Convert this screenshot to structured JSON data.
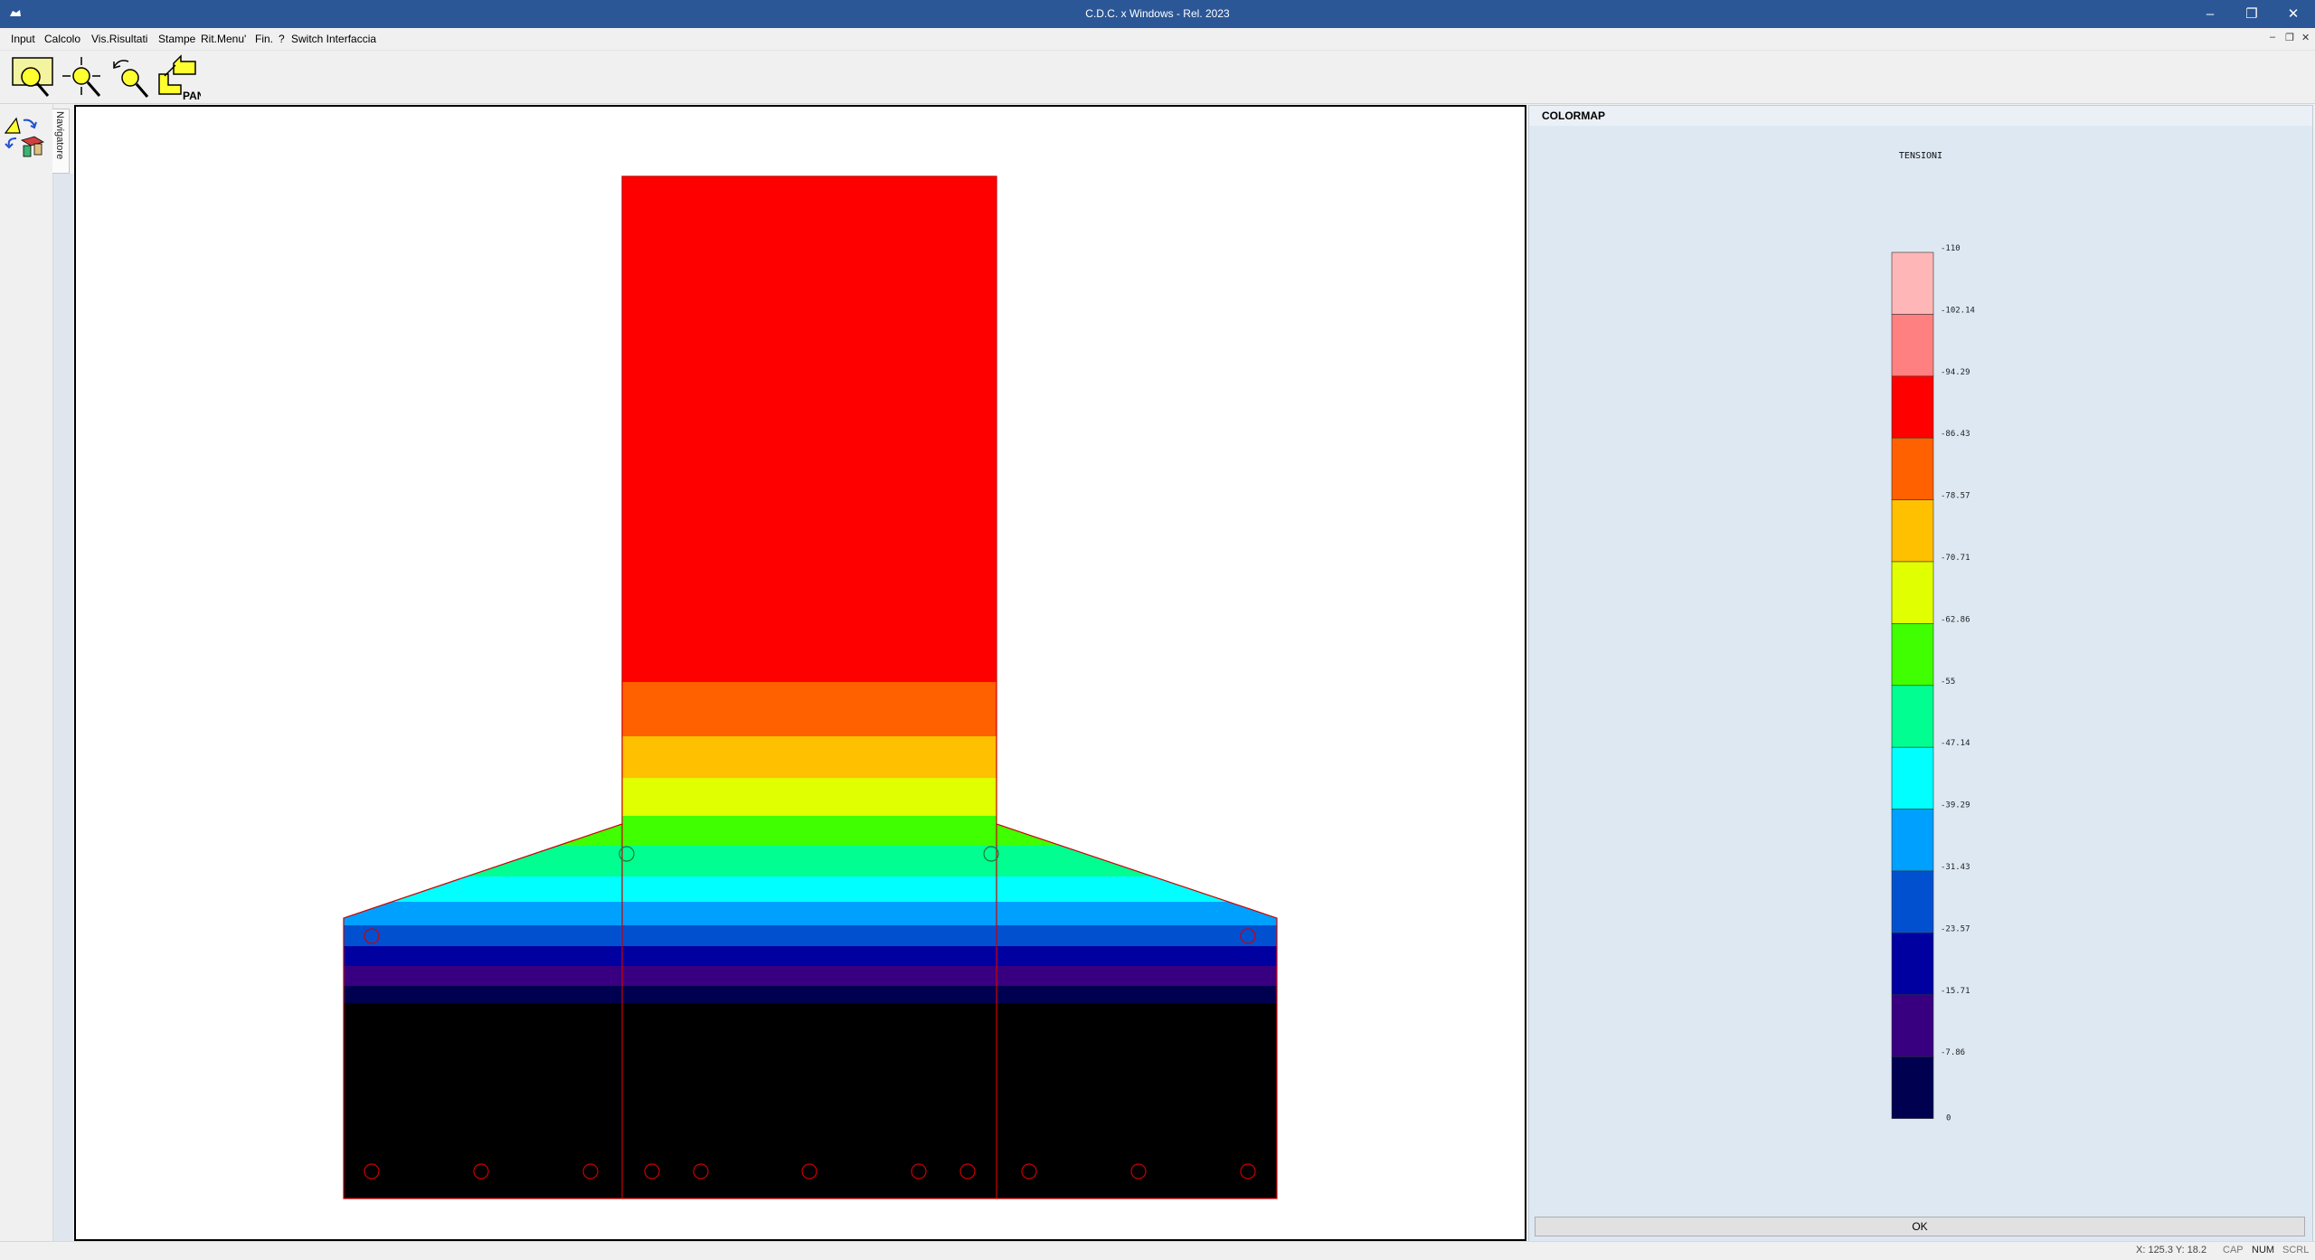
{
  "window": {
    "title": "C.D.C. x Windows - Rel. 2023"
  },
  "menu": [
    {
      "label": "Input"
    },
    {
      "label": "Calcolo"
    },
    {
      "label": "Vis.Risultati"
    },
    {
      "label": "Stampe"
    },
    {
      "label": "Rit.Menu'"
    },
    {
      "label": "Fin."
    },
    {
      "label": "?"
    },
    {
      "label": "Switch Interfaccia"
    }
  ],
  "toolbar": {
    "tools": [
      {
        "icon": "zoom-window-icon"
      },
      {
        "icon": "zoom-extents-icon"
      },
      {
        "icon": "zoom-previous-icon"
      },
      {
        "icon": "pan-icon",
        "label": "PAN"
      }
    ]
  },
  "sidebar": {
    "tab_label": "Navigatore"
  },
  "colormap": {
    "header": "COLORMAP",
    "subtitle": "TENSIONI",
    "classes": [
      {
        "value": "-110",
        "color": "#ffb6b6"
      },
      {
        "value": "-102.14",
        "color": "#ff8080"
      },
      {
        "value": "-94.29",
        "color": "#ff0000"
      },
      {
        "value": "-86.43",
        "color": "#ff6000"
      },
      {
        "value": "-78.57",
        "color": "#ffc000"
      },
      {
        "value": "-70.71",
        "color": "#e0ff00"
      },
      {
        "value": "-62.86",
        "color": "#40ff00"
      },
      {
        "value": "-55",
        "color": "#00ff90"
      },
      {
        "value": "-47.14",
        "color": "#00ffff"
      },
      {
        "value": "-39.29",
        "color": "#00a0ff"
      },
      {
        "value": "-31.43",
        "color": "#0050d0"
      },
      {
        "value": "-23.57",
        "color": "#0000a0"
      },
      {
        "value": "-15.71",
        "color": "#380080"
      },
      {
        "value": "-7.86",
        "color": "#000050"
      }
    ],
    "last_value": "0",
    "ok_label": "OK"
  },
  "model": {
    "base_fill": "#000000",
    "outline_color": "#cc0000",
    "rebar_count": 15
  },
  "status": {
    "coords": "X: 125.3  Y: 18.2",
    "indicators": [
      {
        "label": "CAP",
        "active": false
      },
      {
        "label": "NUM",
        "active": true
      },
      {
        "label": "SCRL",
        "active": false
      }
    ]
  }
}
